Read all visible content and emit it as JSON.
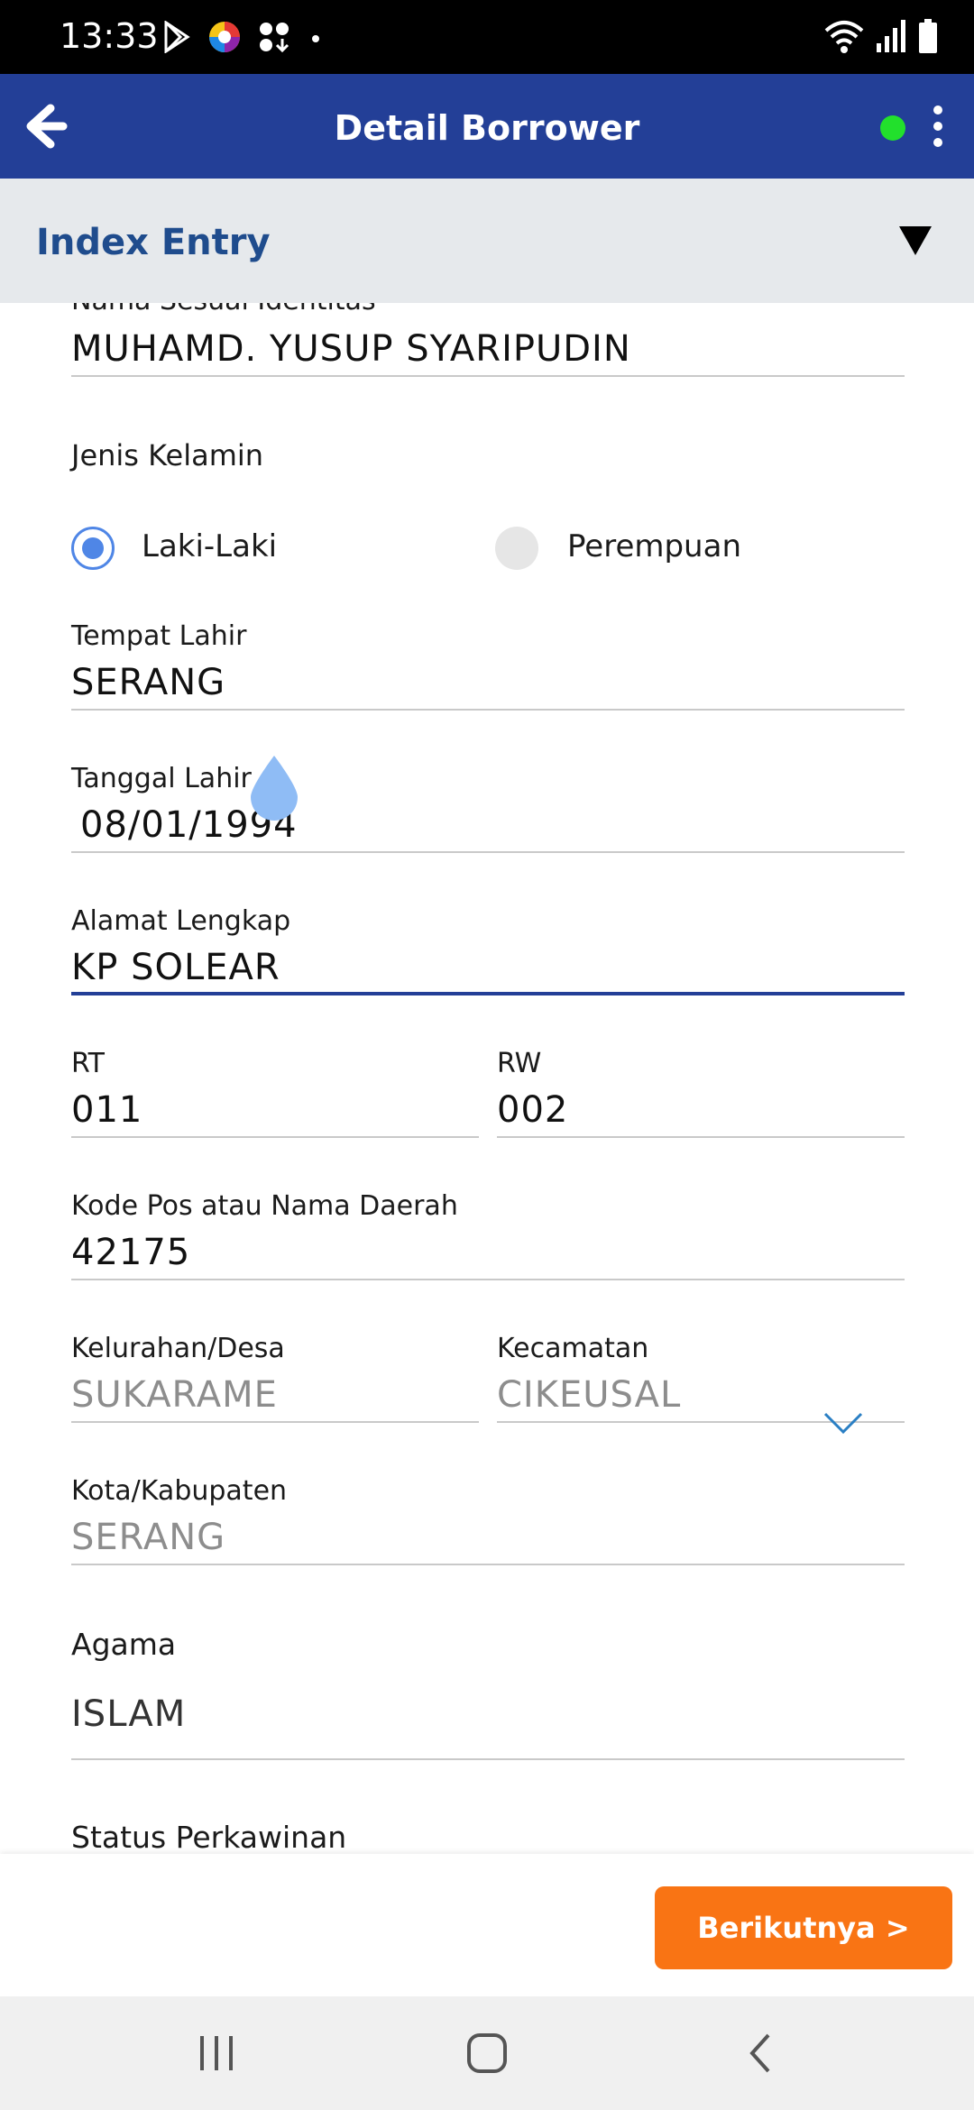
{
  "status_bar": {
    "time": "13:33",
    "left_icons": [
      "play-store-icon",
      "app-circle-icon",
      "grid-download-icon",
      "dot-icon"
    ],
    "right_icons": [
      "wifi-icon",
      "signal-icon",
      "battery-icon"
    ]
  },
  "app_bar": {
    "title": "Detail Borrower",
    "back_icon": "arrow-left-icon",
    "menu_icon": "more-vertical-icon",
    "status_color": "#22e02c"
  },
  "section": {
    "title": "Index Entry",
    "toggle_icon": "triangle-down-icon"
  },
  "form": {
    "nama": {
      "label": "Nama Sesuai Identitas",
      "value": "MUHAMD. YUSUP SYARIPUDIN"
    },
    "jenis_kelamin": {
      "label": "Jenis Kelamin",
      "options": [
        "Laki-Laki",
        "Perempuan"
      ],
      "selected": "Laki-Laki"
    },
    "tempat_lahir": {
      "label": "Tempat Lahir",
      "value": "SERANG"
    },
    "tanggal_lahir": {
      "label": "Tanggal Lahir",
      "value": "08/01/1994"
    },
    "alamat": {
      "label": "Alamat Lengkap",
      "value": "KP SOLEAR"
    },
    "rt": {
      "label": "RT",
      "value": "011"
    },
    "rw": {
      "label": "RW",
      "value": "002"
    },
    "kode_pos": {
      "label": "Kode Pos atau Nama Daerah",
      "value": "42175"
    },
    "kelurahan": {
      "label": "Kelurahan/Desa",
      "value": "SUKARAME"
    },
    "kecamatan": {
      "label": "Kecamatan",
      "value": "CIKEUSAL"
    },
    "kota": {
      "label": "Kota/Kabupaten",
      "value": "SERANG"
    },
    "agama": {
      "label": "Agama",
      "value": "ISLAM"
    },
    "status_perkawinan": {
      "label": "Status Perkawinan"
    }
  },
  "footer": {
    "next_label": "Berikutnya >",
    "next_color": "#f97414"
  },
  "nav_bar": {
    "icons": [
      "recent-apps-icon",
      "home-icon",
      "back-icon"
    ]
  },
  "colors": {
    "primary": "#233f97",
    "section_title": "#1f4c8d",
    "radio_accent": "#4f86e6"
  }
}
